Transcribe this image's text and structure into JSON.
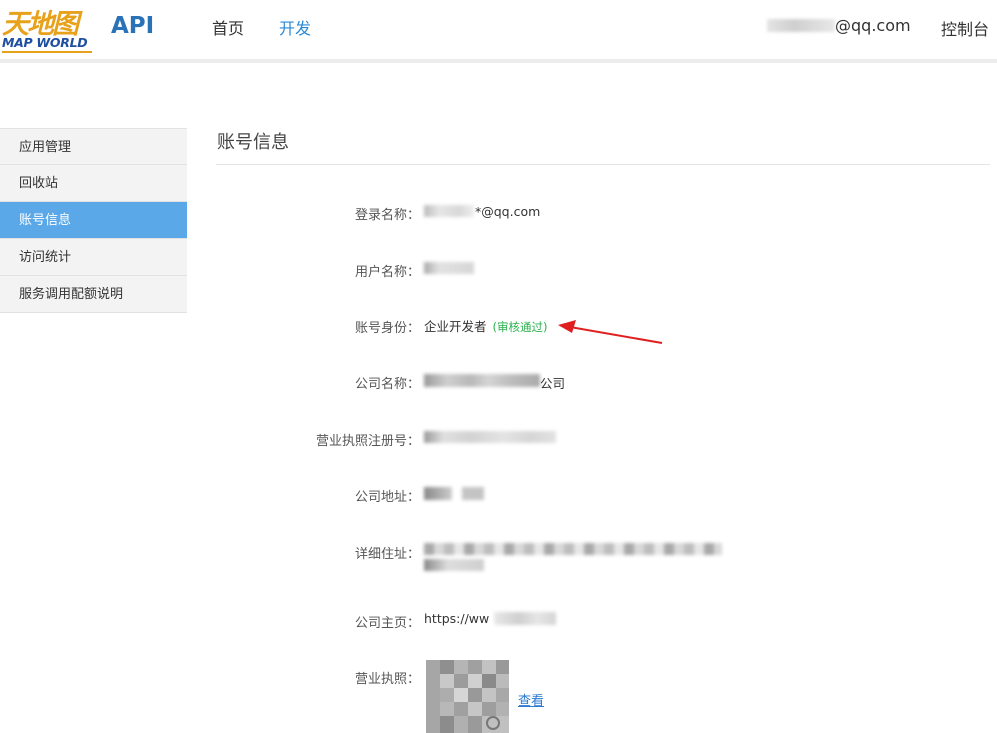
{
  "header": {
    "logo_cn": "天地图",
    "logo_en": "MAP WORLD",
    "api_label": "API",
    "nav": [
      {
        "label": "首页"
      },
      {
        "label": "开发"
      }
    ],
    "user_email_suffix": "@qq.com",
    "console_label": "控制台"
  },
  "sidebar": {
    "items": [
      {
        "label": "应用管理"
      },
      {
        "label": "回收站"
      },
      {
        "label": "账号信息"
      },
      {
        "label": "访问统计"
      },
      {
        "label": "服务调用配额说明"
      }
    ],
    "active_index": 2
  },
  "main": {
    "title": "账号信息",
    "fields": {
      "login_name": {
        "label": "登录名称：",
        "value": "*@qq.com"
      },
      "user_name": {
        "label": "用户名称："
      },
      "account_type": {
        "label": "账号身份：",
        "value": "企业开发者",
        "status": "(审核通过)"
      },
      "company_name": {
        "label": "公司名称：",
        "value_suffix": "公司"
      },
      "license_no": {
        "label": "营业执照注册号："
      },
      "company_address": {
        "label": "公司地址："
      },
      "detail_address": {
        "label": "详细住址："
      },
      "homepage": {
        "label": "公司主页：",
        "value_prefix": "https://ww"
      },
      "license_image": {
        "label": "营业执照：",
        "link_label": "查看"
      }
    }
  },
  "colors": {
    "accent": "#2a8ad6",
    "sidebar_active": "#5aa8e8",
    "status_green": "#2bb24c",
    "annotation_arrow": "#e02020"
  }
}
